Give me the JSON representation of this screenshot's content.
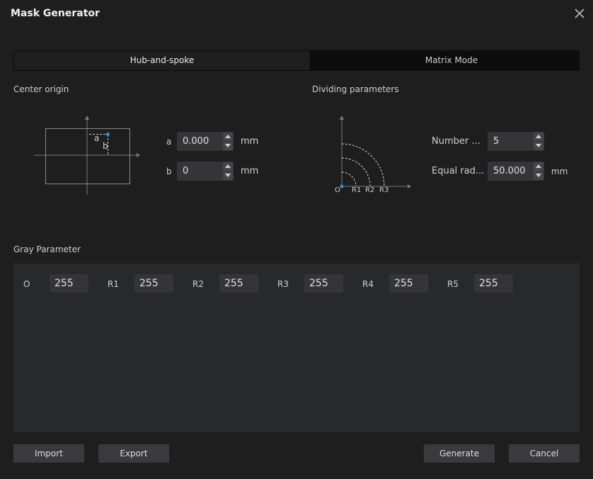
{
  "window": {
    "title": "Mask Generator"
  },
  "tabs": {
    "active": "Hub-and-spoke",
    "inactive": "Matrix Mode"
  },
  "center_origin": {
    "label": "Center origin",
    "diagram": {
      "a": "a",
      "b": "b"
    },
    "a": {
      "label": "a",
      "value": "0.000",
      "unit": "mm"
    },
    "b": {
      "label": "b",
      "value": "0",
      "unit": "mm"
    }
  },
  "dividing": {
    "label": "Dividing parameters",
    "diagram": {
      "o": "O",
      "r1": "R1",
      "r2": "R2",
      "r3": "R3"
    },
    "number": {
      "label": "Number ...",
      "value": "5"
    },
    "equal_radius": {
      "label": "Equal rad...",
      "value": "50.000",
      "unit": "mm"
    }
  },
  "gray": {
    "label": "Gray Parameter",
    "fields": [
      {
        "label": "O",
        "value": "255"
      },
      {
        "label": "R1",
        "value": "255"
      },
      {
        "label": "R2",
        "value": "255"
      },
      {
        "label": "R3",
        "value": "255"
      },
      {
        "label": "R4",
        "value": "255"
      },
      {
        "label": "R5",
        "value": "255"
      }
    ]
  },
  "buttons": {
    "import": "Import",
    "export": "Export",
    "generate": "Generate",
    "cancel": "Cancel"
  }
}
